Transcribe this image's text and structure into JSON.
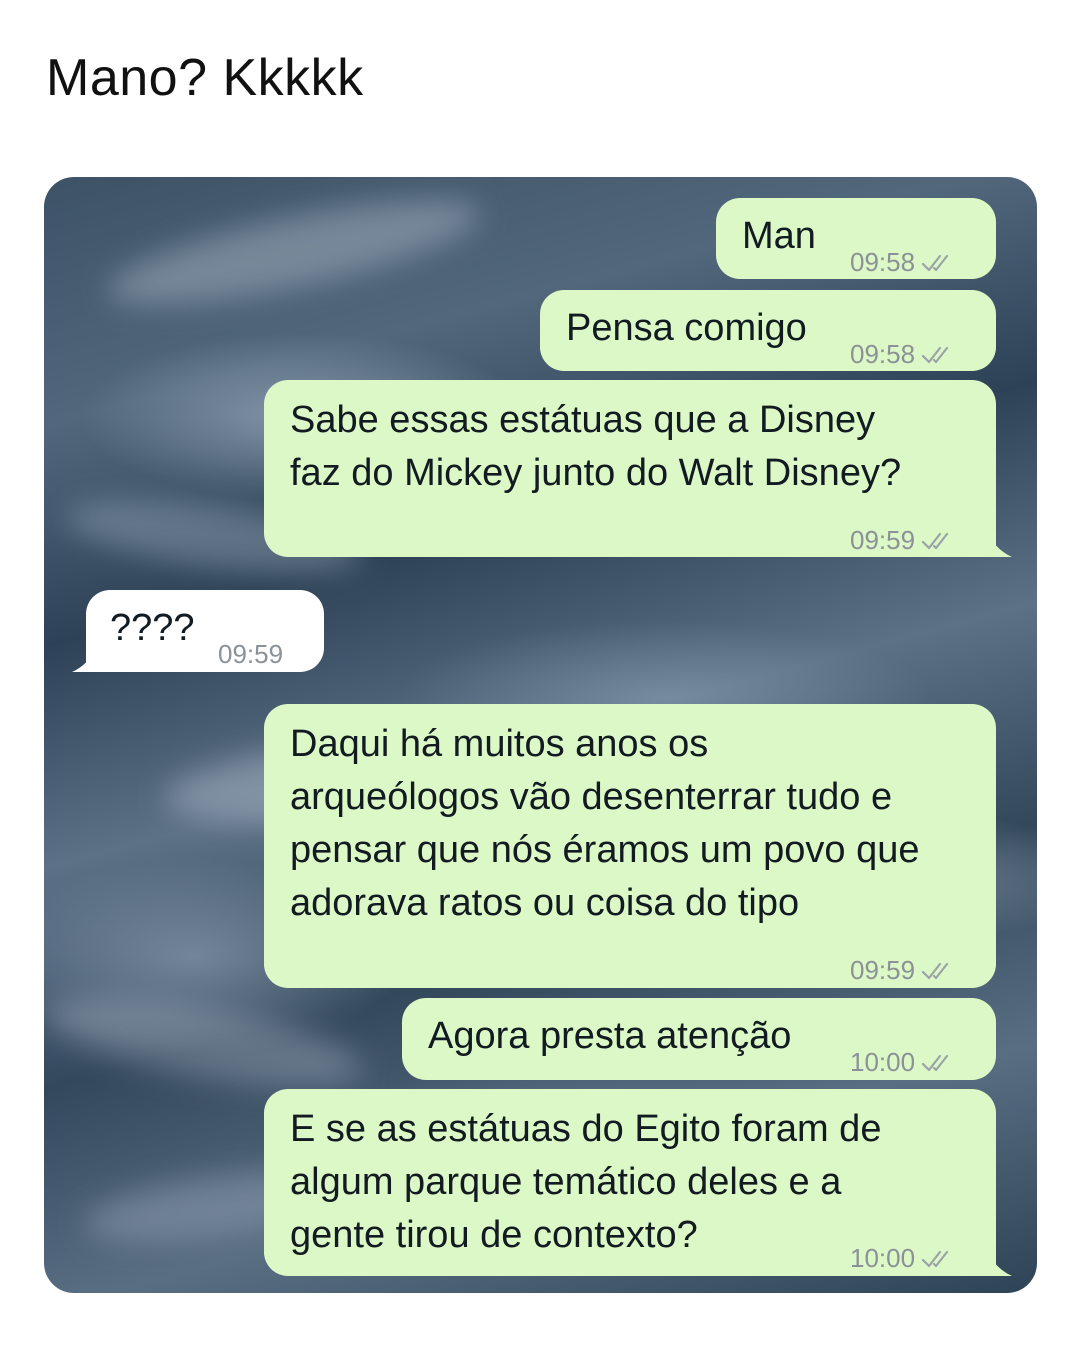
{
  "post": {
    "caption": "Mano? Kkkkk"
  },
  "chat": {
    "messages": [
      {
        "direction": "outgoing",
        "text": "Man",
        "time": "09:58",
        "status": "read-ticks-icon"
      },
      {
        "direction": "outgoing",
        "text": "Pensa comigo",
        "time": "09:58",
        "status": "read-ticks-icon"
      },
      {
        "direction": "outgoing",
        "text": "Sabe essas estátuas que a Disney\nfaz do Mickey junto do Walt Disney?",
        "time": "09:59",
        "status": "read-ticks-icon"
      },
      {
        "direction": "incoming",
        "text": "????",
        "time": "09:59"
      },
      {
        "direction": "outgoing",
        "text": "Daqui há muitos anos os\narqueólogos vão desenterrar tudo e\npensar que nós éramos um povo que\nadorava ratos ou coisa do tipo",
        "time": "09:59",
        "status": "read-ticks-icon"
      },
      {
        "direction": "outgoing",
        "text": "Agora presta atenção",
        "time": "10:00",
        "status": "read-ticks-icon"
      },
      {
        "direction": "outgoing",
        "text": "E se as estátuas do Egito foram de\nalgum parque temático deles e a\ngente tirou de contexto?",
        "time": "10:00",
        "status": "read-ticks-icon"
      }
    ]
  },
  "colors": {
    "outgoing_bubble": "#dcf8c6",
    "incoming_bubble": "#ffffff",
    "timestamp": "#8a9298"
  }
}
